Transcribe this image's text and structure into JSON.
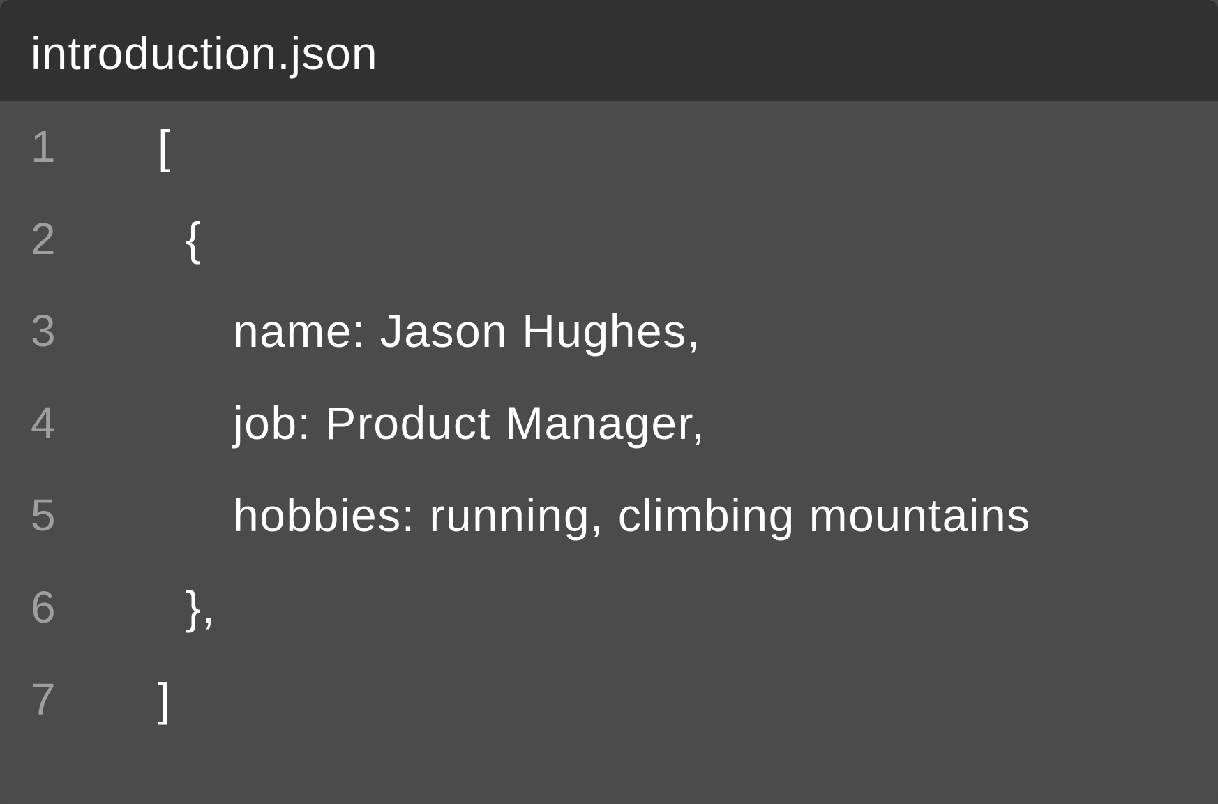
{
  "window": {
    "title": "introduction.json"
  },
  "editor": {
    "lines": [
      {
        "number": "1",
        "text": "["
      },
      {
        "number": "2",
        "text": "{"
      },
      {
        "number": "3",
        "text": "name: Jason Hughes,"
      },
      {
        "number": "4",
        "text": "job: Product Manager,"
      },
      {
        "number": "5",
        "text": "hobbies: running, climbing mountains"
      },
      {
        "number": "6",
        "text": "},"
      },
      {
        "number": "7",
        "text": "]"
      }
    ]
  },
  "colors": {
    "titlebar_background": "#313131",
    "editor_background": "#4b4b4b",
    "text": "#ffffff",
    "line_number": "#9e9e9e"
  }
}
